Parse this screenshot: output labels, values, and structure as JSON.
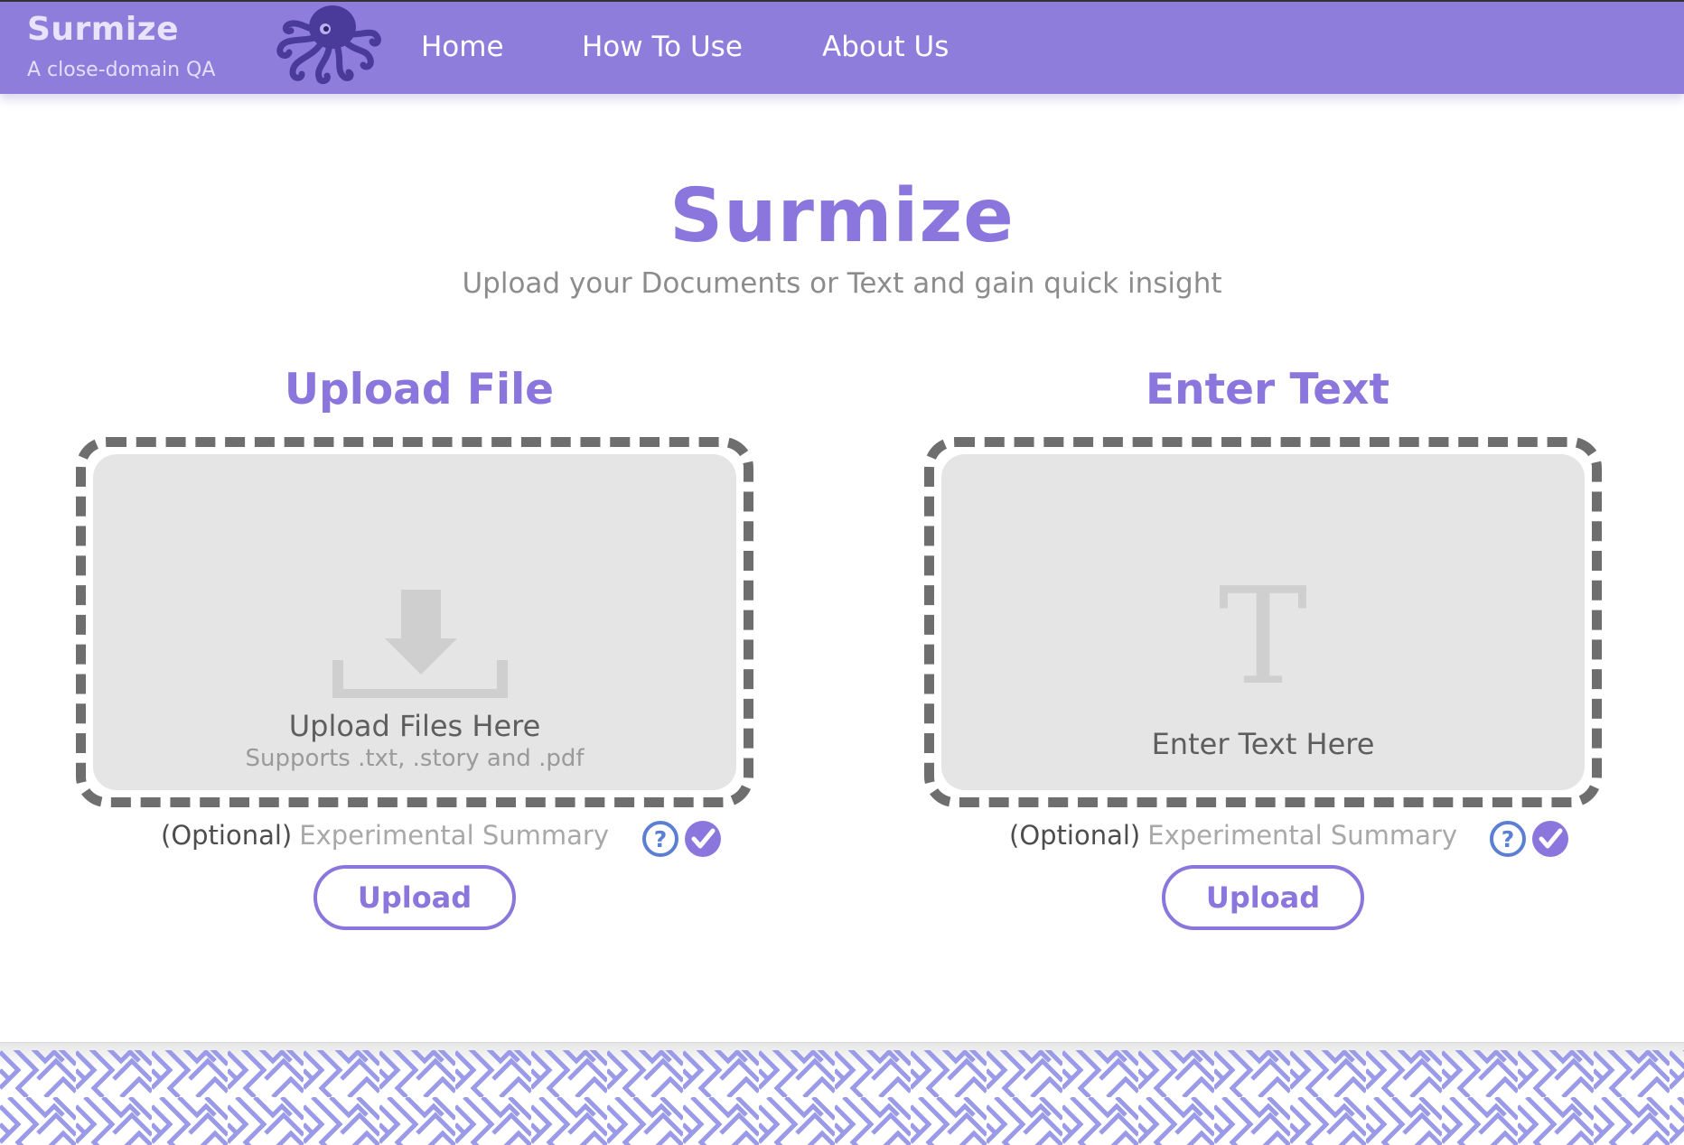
{
  "navbar": {
    "brand_name": "Surmize",
    "brand_tagline": "A close-domain QA",
    "logo_icon": "octopus-icon",
    "links": [
      {
        "label": "Home"
      },
      {
        "label": "How To Use"
      },
      {
        "label": "About Us"
      }
    ]
  },
  "hero": {
    "title": "Surmize",
    "subtitle": "Upload your Documents or Text and gain quick insight"
  },
  "upload_file": {
    "heading": "Upload File",
    "dropzone_title": "Upload Files Here",
    "dropzone_hint": "Supports .txt, .story and .pdf",
    "dropzone_icon": "download-tray-icon",
    "optional_label": "(Optional)",
    "experimental_label": "Experimental Summary",
    "summary_checked": true,
    "button_label": "Upload"
  },
  "enter_text": {
    "heading": "Enter Text",
    "dropzone_title": "Enter Text Here",
    "dropzone_glyph": "T",
    "optional_label": "(Optional)",
    "experimental_label": "Experimental Summary",
    "summary_checked": true,
    "button_label": "Upload"
  },
  "colors": {
    "accent": "#8a76dc",
    "navbar": "#8f7ddc",
    "help_icon": "#5b7fd4",
    "footer_pattern": "#9a9ae8"
  }
}
